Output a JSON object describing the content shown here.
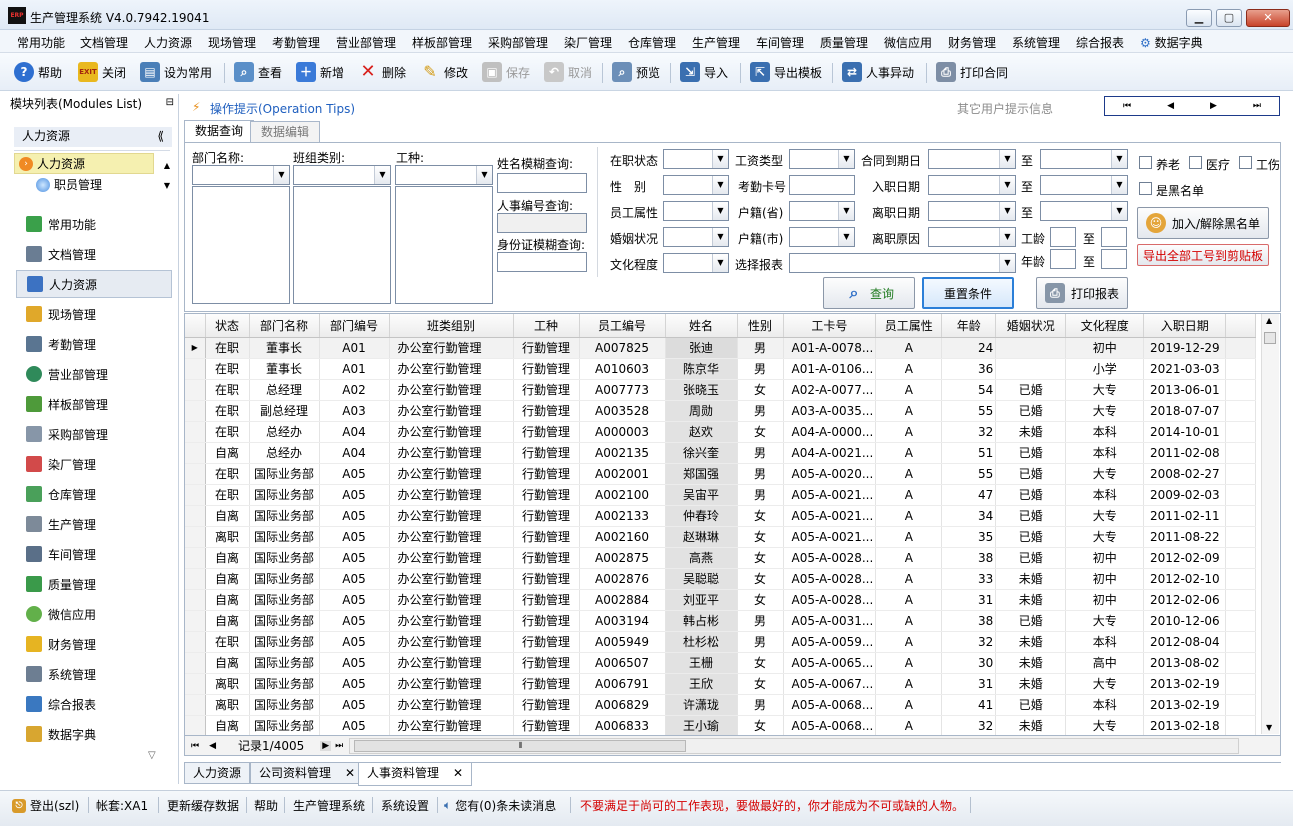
{
  "window": {
    "title": "生产管理系统 V4.0.7942.19041",
    "logo_text": "ERP"
  },
  "menu": [
    "常用功能",
    "文档管理",
    "人力资源",
    "现场管理",
    "考勤管理",
    "营业部管理",
    "样板部管理",
    "采购部管理",
    "染厂管理",
    "仓库管理",
    "生产管理",
    "车间管理",
    "质量管理",
    "微信应用",
    "财务管理",
    "系统管理",
    "综合报表",
    "数据字典"
  ],
  "toolbar": {
    "help": "帮助",
    "close": "关闭",
    "set_common": "设为常用",
    "view": "查看",
    "add": "新增",
    "delete": "删除",
    "edit": "修改",
    "save": "保存",
    "cancel": "取消",
    "preview": "预览",
    "import": "导入",
    "export_template": "导出模板",
    "hr_change": "人事异动",
    "print_contract": "打印合同",
    "exit_badge": "EXIT"
  },
  "left": {
    "header": "模块列表(Modules List)",
    "pin": "⊟",
    "group": "人力资源",
    "collapse": "⟪",
    "tree": [
      {
        "label": "人力资源"
      },
      {
        "label": "职员管理"
      }
    ],
    "nav": [
      "常用功能",
      "文档管理",
      "人力资源",
      "现场管理",
      "考勤管理",
      "营业部管理",
      "样板部管理",
      "采购部管理",
      "染厂管理",
      "仓库管理",
      "生产管理",
      "车间管理",
      "质量管理",
      "微信应用",
      "财务管理",
      "系统管理",
      "综合报表",
      "数据字典"
    ],
    "nav_selected": "人力资源",
    "more": "▽"
  },
  "tips": {
    "title": "操作提示(Operation Tips)",
    "other": "其它用户提示信息"
  },
  "pager_controls": [
    "⏮",
    "◀",
    "▶",
    "⏭"
  ],
  "tabs": [
    "数据查询",
    "数据编辑"
  ],
  "filter": {
    "dept": "部门名称:",
    "team": "班组类别:",
    "worktype": "工种:",
    "name_fuzzy": "姓名模糊查询:",
    "hr_no": "人事编号查询:",
    "id_fuzzy": "身份证模糊查询:",
    "status": "在职状态",
    "gender": "性　别",
    "attr": "员工属性",
    "marital": "婚姻状况",
    "education": "文化程度",
    "salary_type": "工资类型",
    "attendance_card": "考勤卡号",
    "province": "户籍(省)",
    "city": "户籍(市)",
    "report": "选择报表",
    "contract_due": "合同到期日",
    "entry_date": "入职日期",
    "leave_date": "离职日期",
    "leave_reason": "离职原因",
    "to": "至",
    "seniority": "工龄",
    "age": "年龄",
    "pension": "养老",
    "medical": "医疗",
    "injury": "工伤",
    "blacklist": "是黑名单",
    "btn_blacklist": "加入/解除黑名单",
    "btn_export": "导出全部工号到剪贴板",
    "btn_query": "查询",
    "btn_reset": "重置条件",
    "btn_print": "打印报表"
  },
  "grid": {
    "columns": [
      "状态",
      "部门名称",
      "部门编号",
      "班类组别",
      "工种",
      "员工编号",
      "姓名",
      "性别",
      "工卡号",
      "员工属性",
      "年龄",
      "婚姻状况",
      "文化程度",
      "入职日期"
    ],
    "rows": [
      [
        "在职",
        "董事长",
        "A01",
        "办公室行勤管理",
        "行勤管理",
        "A007825",
        "张迪",
        "男",
        "A01-A-0078...",
        "A",
        "24",
        "",
        "初中",
        "2019-12-29"
      ],
      [
        "在职",
        "董事长",
        "A01",
        "办公室行勤管理",
        "行勤管理",
        "A010603",
        "陈京华",
        "男",
        "A01-A-0106...",
        "A",
        "36",
        "",
        "小学",
        "2021-03-03"
      ],
      [
        "在职",
        "总经理",
        "A02",
        "办公室行勤管理",
        "行勤管理",
        "A007773",
        "张晓玉",
        "女",
        "A02-A-0077...",
        "A",
        "54",
        "已婚",
        "大专",
        "2013-06-01"
      ],
      [
        "在职",
        "副总经理",
        "A03",
        "办公室行勤管理",
        "行勤管理",
        "A003528",
        "周勋",
        "男",
        "A03-A-0035...",
        "A",
        "55",
        "已婚",
        "大专",
        "2018-07-07"
      ],
      [
        "在职",
        "总经办",
        "A04",
        "办公室行勤管理",
        "行勤管理",
        "A000003",
        "赵欢",
        "女",
        "A04-A-0000...",
        "A",
        "32",
        "未婚",
        "本科",
        "2014-10-01"
      ],
      [
        "自离",
        "总经办",
        "A04",
        "办公室行勤管理",
        "行勤管理",
        "A002135",
        "徐兴奎",
        "男",
        "A04-A-0021...",
        "A",
        "51",
        "已婚",
        "本科",
        "2011-02-08"
      ],
      [
        "在职",
        "国际业务部",
        "A05",
        "办公室行勤管理",
        "行勤管理",
        "A002001",
        "郑国强",
        "男",
        "A05-A-0020...",
        "A",
        "55",
        "已婚",
        "大专",
        "2008-02-27"
      ],
      [
        "在职",
        "国际业务部",
        "A05",
        "办公室行勤管理",
        "行勤管理",
        "A002100",
        "吴宙平",
        "男",
        "A05-A-0021...",
        "A",
        "47",
        "已婚",
        "本科",
        "2009-02-03"
      ],
      [
        "自离",
        "国际业务部",
        "A05",
        "办公室行勤管理",
        "行勤管理",
        "A002133",
        "仲春玲",
        "女",
        "A05-A-0021...",
        "A",
        "34",
        "已婚",
        "大专",
        "2011-02-11"
      ],
      [
        "离职",
        "国际业务部",
        "A05",
        "办公室行勤管理",
        "行勤管理",
        "A002160",
        "赵琳琳",
        "女",
        "A05-A-0021...",
        "A",
        "35",
        "已婚",
        "大专",
        "2011-08-22"
      ],
      [
        "自离",
        "国际业务部",
        "A05",
        "办公室行勤管理",
        "行勤管理",
        "A002875",
        "高燕",
        "女",
        "A05-A-0028...",
        "A",
        "38",
        "已婚",
        "初中",
        "2012-02-09"
      ],
      [
        "自离",
        "国际业务部",
        "A05",
        "办公室行勤管理",
        "行勤管理",
        "A002876",
        "吴聪聪",
        "女",
        "A05-A-0028...",
        "A",
        "33",
        "未婚",
        "初中",
        "2012-02-10"
      ],
      [
        "自离",
        "国际业务部",
        "A05",
        "办公室行勤管理",
        "行勤管理",
        "A002884",
        "刘亚平",
        "女",
        "A05-A-0028...",
        "A",
        "31",
        "未婚",
        "初中",
        "2012-02-06"
      ],
      [
        "自离",
        "国际业务部",
        "A05",
        "办公室行勤管理",
        "行勤管理",
        "A003194",
        "韩占彬",
        "男",
        "A05-A-0031...",
        "A",
        "38",
        "已婚",
        "大专",
        "2010-12-06"
      ],
      [
        "在职",
        "国际业务部",
        "A05",
        "办公室行勤管理",
        "行勤管理",
        "A005949",
        "杜杉松",
        "男",
        "A05-A-0059...",
        "A",
        "32",
        "未婚",
        "本科",
        "2012-08-04"
      ],
      [
        "自离",
        "国际业务部",
        "A05",
        "办公室行勤管理",
        "行勤管理",
        "A006507",
        "王栅",
        "女",
        "A05-A-0065...",
        "A",
        "30",
        "未婚",
        "高中",
        "2013-08-02"
      ],
      [
        "离职",
        "国际业务部",
        "A05",
        "办公室行勤管理",
        "行勤管理",
        "A006791",
        "王欣",
        "女",
        "A05-A-0067...",
        "A",
        "31",
        "未婚",
        "大专",
        "2013-02-19"
      ],
      [
        "离职",
        "国际业务部",
        "A05",
        "办公室行勤管理",
        "行勤管理",
        "A006829",
        "许潇珑",
        "男",
        "A05-A-0068...",
        "A",
        "41",
        "已婚",
        "本科",
        "2013-02-19"
      ],
      [
        "自离",
        "国际业务部",
        "A05",
        "办公室行勤管理",
        "行勤管理",
        "A006833",
        "王小瑜",
        "女",
        "A05-A-0068...",
        "A",
        "32",
        "未婚",
        "大专",
        "2013-02-18"
      ]
    ]
  },
  "navbar": {
    "first": "⏮",
    "prev": "◀",
    "record": "记录1/4005",
    "next": "▶",
    "last": "⏭",
    "thumb": "⦀"
  },
  "bottom_tabs": [
    {
      "label": "人力资源",
      "closable": false
    },
    {
      "label": "公司资料管理",
      "closable": true
    },
    {
      "label": "人事资料管理",
      "closable": true
    }
  ],
  "status": {
    "logout": "登出(szl)",
    "account": "帐套:XA1",
    "refresh_cache": "更新缓存数据",
    "help": "帮助",
    "system": "生产管理系统",
    "settings": "系统设置",
    "messages": "您有(0)条未读消息",
    "motto": "不要满足于尚可的工作表现，要做最好的，你才能成为不可或缺的人物。",
    "motto_color": "#d40000"
  }
}
